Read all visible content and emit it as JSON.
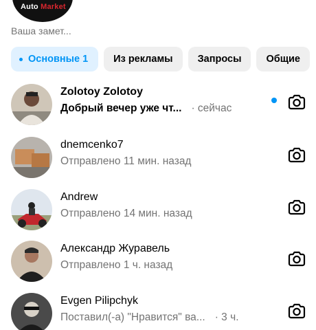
{
  "note": {
    "avatar_text_1": "Auto",
    "avatar_text_2": "Market",
    "text": "Ваша замет..."
  },
  "tabs": [
    {
      "label": "Основные 1",
      "active": true
    },
    {
      "label": "Из рекламы",
      "active": false
    },
    {
      "label": "Запросы",
      "active": false
    },
    {
      "label": "Общие",
      "active": false
    }
  ],
  "threads": [
    {
      "name": "Zolotoy Zolotoy",
      "preview": "Добрый вечер уже чт...",
      "time": "· сейчас",
      "unread": true,
      "icon": "camera-icon"
    },
    {
      "name": "dnemcenko7",
      "preview": "Отправлено 11 мин. назад",
      "time": "",
      "unread": false,
      "icon": "camera-icon"
    },
    {
      "name": "Andrew",
      "preview": "Отправлено 14 мин. назад",
      "time": "",
      "unread": false,
      "icon": "camera-icon"
    },
    {
      "name": "Александр Журавель",
      "preview": "Отправлено 1 ч. назад",
      "time": "",
      "unread": false,
      "icon": "camera-icon"
    },
    {
      "name": "Evgen Pilipchyk",
      "preview": "Поставил(-а) \"Нравится\" ва...",
      "time": "· 3 ч.",
      "unread": false,
      "icon": "camera-icon"
    }
  ],
  "colors": {
    "accent": "#0095f6",
    "active_tab_bg": "#e0f1ff",
    "tab_bg": "#efefef",
    "secondary_text": "#737373"
  }
}
